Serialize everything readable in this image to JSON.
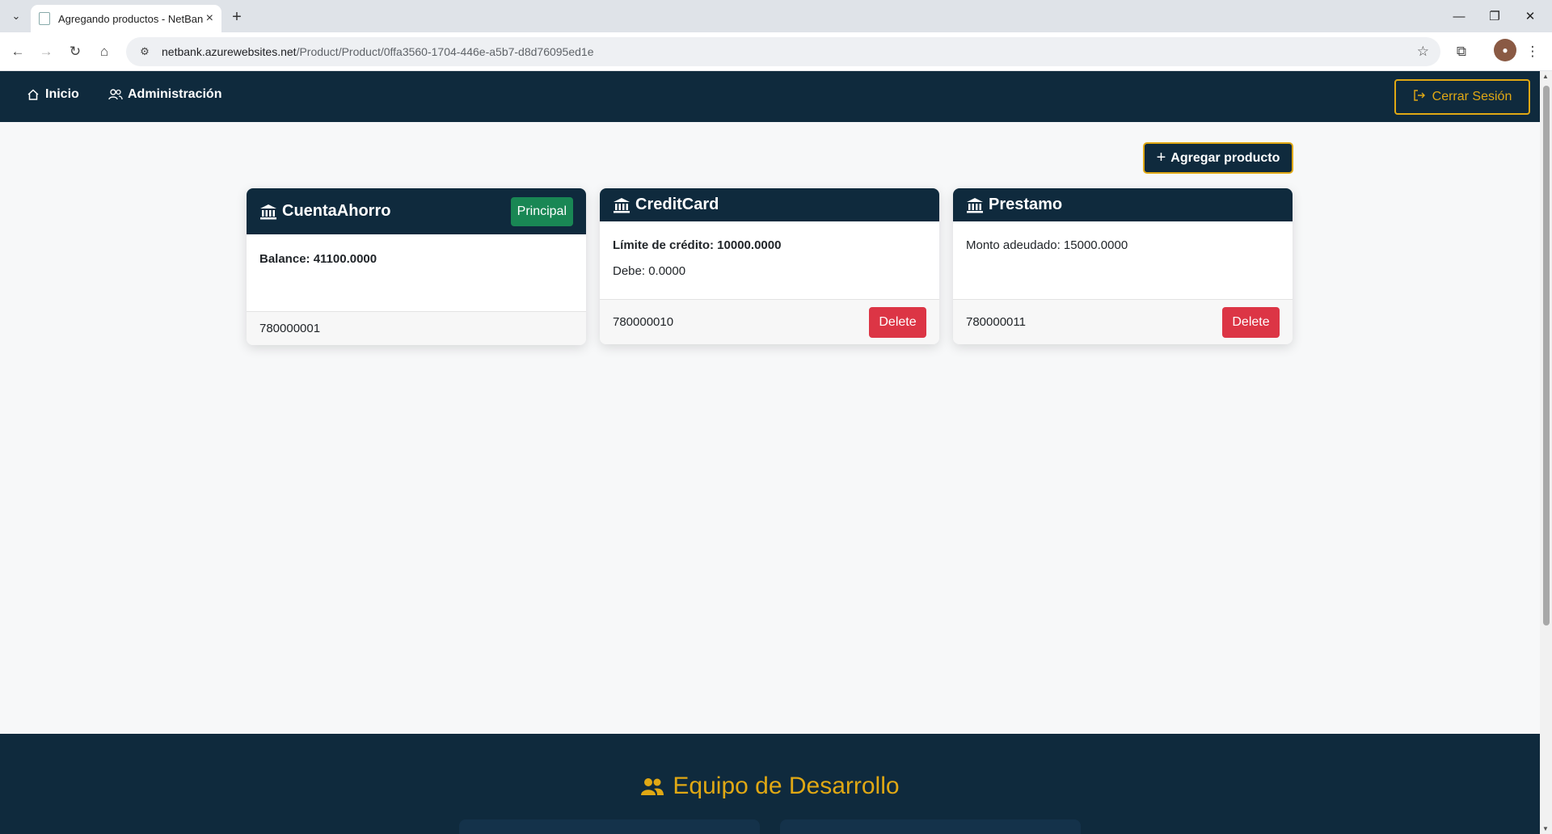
{
  "browser": {
    "tab_title": "Agregando productos - NetBank",
    "url_host": "netbank.azurewebsites.net",
    "url_path": "/Product/Product/0ffa3560-1704-446e-a5b7-d8d76095ed1e"
  },
  "nav": {
    "home_label": "Inicio",
    "admin_label": "Administración",
    "logout_label": "Cerrar Sesión"
  },
  "actions": {
    "add_product_label": "Agregar producto"
  },
  "products": [
    {
      "name": "CuentaAhorro",
      "badge": "Principal",
      "lines": [
        "Balance: 41100.0000"
      ],
      "number": "780000001"
    },
    {
      "name": "CreditCard",
      "lines": [
        "Límite de crédito: 10000.0000",
        "Debe: 0.0000"
      ],
      "number": "780000010",
      "delete_label": "Delete"
    },
    {
      "name": "Prestamo",
      "lines": [
        "Monto adeudado: 15000.0000"
      ],
      "number": "780000011",
      "delete_label": "Delete"
    }
  ],
  "footer": {
    "team_title": "Equipo de Desarrollo"
  },
  "colors": {
    "navy": "#0f2a3d",
    "gold": "#e0a814",
    "success": "#198754",
    "danger": "#dc3545"
  }
}
